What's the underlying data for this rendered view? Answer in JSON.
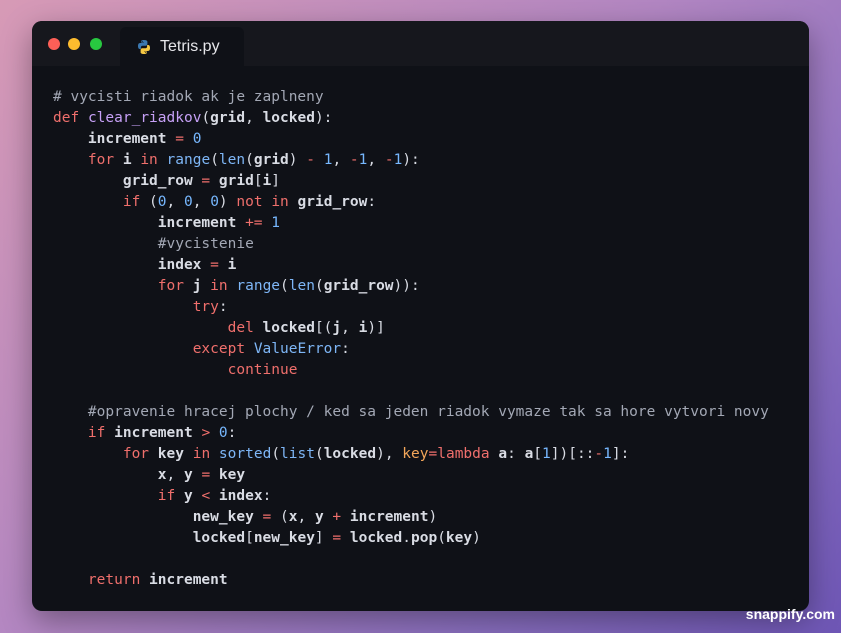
{
  "window": {
    "tab_title": "Tetris.py",
    "tab_icon": "python-icon"
  },
  "colors": {
    "close": "#fe5f57",
    "minimize": "#febc2e",
    "maximize": "#28c840",
    "editor_bg": "#0f1117",
    "keyword": "#ef6f6c",
    "function": "#c6a0f6",
    "builtin": "#7eb6f6",
    "number": "#77b8ff",
    "comment": "#a3a8b5",
    "param": "#f2a65a"
  },
  "code_lines": [
    [
      [
        "cm",
        "# vycisti riadok ak je zaplneny"
      ]
    ],
    [
      [
        "kw",
        "def"
      ],
      [
        "pn",
        " "
      ],
      [
        "fn",
        "clear_riadkov"
      ],
      [
        "pn",
        "("
      ],
      [
        "id",
        "grid"
      ],
      [
        "pn",
        ", "
      ],
      [
        "id",
        "locked"
      ],
      [
        "pn",
        "):"
      ]
    ],
    [
      [
        "pn",
        "    "
      ],
      [
        "id",
        "increment"
      ],
      [
        "pn",
        " "
      ],
      [
        "op",
        "="
      ],
      [
        "pn",
        " "
      ],
      [
        "num",
        "0"
      ]
    ],
    [
      [
        "pn",
        "    "
      ],
      [
        "kw",
        "for"
      ],
      [
        "pn",
        " "
      ],
      [
        "id",
        "i"
      ],
      [
        "pn",
        " "
      ],
      [
        "kw",
        "in"
      ],
      [
        "pn",
        " "
      ],
      [
        "bi",
        "range"
      ],
      [
        "pn",
        "("
      ],
      [
        "bi",
        "len"
      ],
      [
        "pn",
        "("
      ],
      [
        "id",
        "grid"
      ],
      [
        "pn",
        ") "
      ],
      [
        "op",
        "-"
      ],
      [
        "pn",
        " "
      ],
      [
        "num",
        "1"
      ],
      [
        "pn",
        ", "
      ],
      [
        "op",
        "-"
      ],
      [
        "num",
        "1"
      ],
      [
        "pn",
        ", "
      ],
      [
        "op",
        "-"
      ],
      [
        "num",
        "1"
      ],
      [
        "pn",
        "):"
      ]
    ],
    [
      [
        "pn",
        "        "
      ],
      [
        "id",
        "grid_row"
      ],
      [
        "pn",
        " "
      ],
      [
        "op",
        "="
      ],
      [
        "pn",
        " "
      ],
      [
        "id",
        "grid"
      ],
      [
        "pn",
        "["
      ],
      [
        "id",
        "i"
      ],
      [
        "pn",
        "]"
      ]
    ],
    [
      [
        "pn",
        "        "
      ],
      [
        "kw",
        "if"
      ],
      [
        "pn",
        " ("
      ],
      [
        "num",
        "0"
      ],
      [
        "pn",
        ", "
      ],
      [
        "num",
        "0"
      ],
      [
        "pn",
        ", "
      ],
      [
        "num",
        "0"
      ],
      [
        "pn",
        ") "
      ],
      [
        "kw",
        "not"
      ],
      [
        "pn",
        " "
      ],
      [
        "kw",
        "in"
      ],
      [
        "pn",
        " "
      ],
      [
        "id",
        "grid_row"
      ],
      [
        "pn",
        ":"
      ]
    ],
    [
      [
        "pn",
        "            "
      ],
      [
        "id",
        "increment"
      ],
      [
        "pn",
        " "
      ],
      [
        "op",
        "+="
      ],
      [
        "pn",
        " "
      ],
      [
        "num",
        "1"
      ]
    ],
    [
      [
        "pn",
        "            "
      ],
      [
        "cm",
        "#vycistenie"
      ]
    ],
    [
      [
        "pn",
        "            "
      ],
      [
        "id",
        "index"
      ],
      [
        "pn",
        " "
      ],
      [
        "op",
        "="
      ],
      [
        "pn",
        " "
      ],
      [
        "id",
        "i"
      ]
    ],
    [
      [
        "pn",
        "            "
      ],
      [
        "kw",
        "for"
      ],
      [
        "pn",
        " "
      ],
      [
        "id",
        "j"
      ],
      [
        "pn",
        " "
      ],
      [
        "kw",
        "in"
      ],
      [
        "pn",
        " "
      ],
      [
        "bi",
        "range"
      ],
      [
        "pn",
        "("
      ],
      [
        "bi",
        "len"
      ],
      [
        "pn",
        "("
      ],
      [
        "id",
        "grid_row"
      ],
      [
        "pn",
        ")):"
      ]
    ],
    [
      [
        "pn",
        "                "
      ],
      [
        "kw",
        "try"
      ],
      [
        "pn",
        ":"
      ]
    ],
    [
      [
        "pn",
        "                    "
      ],
      [
        "kw",
        "del"
      ],
      [
        "pn",
        " "
      ],
      [
        "id",
        "locked"
      ],
      [
        "pn",
        "[("
      ],
      [
        "id",
        "j"
      ],
      [
        "pn",
        ", "
      ],
      [
        "id",
        "i"
      ],
      [
        "pn",
        ")]"
      ]
    ],
    [
      [
        "pn",
        "                "
      ],
      [
        "kw",
        "except"
      ],
      [
        "pn",
        " "
      ],
      [
        "bi",
        "ValueError"
      ],
      [
        "pn",
        ":"
      ]
    ],
    [
      [
        "pn",
        "                    "
      ],
      [
        "kw",
        "continue"
      ]
    ],
    [
      [
        "pn",
        ""
      ]
    ],
    [
      [
        "pn",
        "    "
      ],
      [
        "cm",
        "#opravenie hracej plochy / ked sa jeden riadok vymaze tak sa hore vytvori novy"
      ]
    ],
    [
      [
        "pn",
        "    "
      ],
      [
        "kw",
        "if"
      ],
      [
        "pn",
        " "
      ],
      [
        "id",
        "increment"
      ],
      [
        "pn",
        " "
      ],
      [
        "op",
        ">"
      ],
      [
        "pn",
        " "
      ],
      [
        "num",
        "0"
      ],
      [
        "pn",
        ":"
      ]
    ],
    [
      [
        "pn",
        "        "
      ],
      [
        "kw",
        "for"
      ],
      [
        "pn",
        " "
      ],
      [
        "id",
        "key"
      ],
      [
        "pn",
        " "
      ],
      [
        "kw",
        "in"
      ],
      [
        "pn",
        " "
      ],
      [
        "bi",
        "sorted"
      ],
      [
        "pn",
        "("
      ],
      [
        "bi",
        "list"
      ],
      [
        "pn",
        "("
      ],
      [
        "id",
        "locked"
      ],
      [
        "pn",
        "), "
      ],
      [
        "pr",
        "key"
      ],
      [
        "op",
        "="
      ],
      [
        "kw",
        "lambda"
      ],
      [
        "pn",
        " "
      ],
      [
        "id",
        "a"
      ],
      [
        "pn",
        ": "
      ],
      [
        "id",
        "a"
      ],
      [
        "pn",
        "["
      ],
      [
        "num",
        "1"
      ],
      [
        "pn",
        "])[::"
      ],
      [
        "op",
        "-"
      ],
      [
        "num",
        "1"
      ],
      [
        "pn",
        "]:"
      ]
    ],
    [
      [
        "pn",
        "            "
      ],
      [
        "id",
        "x"
      ],
      [
        "pn",
        ", "
      ],
      [
        "id",
        "y"
      ],
      [
        "pn",
        " "
      ],
      [
        "op",
        "="
      ],
      [
        "pn",
        " "
      ],
      [
        "id",
        "key"
      ]
    ],
    [
      [
        "pn",
        "            "
      ],
      [
        "kw",
        "if"
      ],
      [
        "pn",
        " "
      ],
      [
        "id",
        "y"
      ],
      [
        "pn",
        " "
      ],
      [
        "op",
        "<"
      ],
      [
        "pn",
        " "
      ],
      [
        "id",
        "index"
      ],
      [
        "pn",
        ":"
      ]
    ],
    [
      [
        "pn",
        "                "
      ],
      [
        "id",
        "new_key"
      ],
      [
        "pn",
        " "
      ],
      [
        "op",
        "="
      ],
      [
        "pn",
        " ("
      ],
      [
        "id",
        "x"
      ],
      [
        "pn",
        ", "
      ],
      [
        "id",
        "y"
      ],
      [
        "pn",
        " "
      ],
      [
        "op",
        "+"
      ],
      [
        "pn",
        " "
      ],
      [
        "id",
        "increment"
      ],
      [
        "pn",
        ")"
      ]
    ],
    [
      [
        "pn",
        "                "
      ],
      [
        "id",
        "locked"
      ],
      [
        "pn",
        "["
      ],
      [
        "id",
        "new_key"
      ],
      [
        "pn",
        "] "
      ],
      [
        "op",
        "="
      ],
      [
        "pn",
        " "
      ],
      [
        "id",
        "locked"
      ],
      [
        "pn",
        "."
      ],
      [
        "id",
        "pop"
      ],
      [
        "pn",
        "("
      ],
      [
        "id",
        "key"
      ],
      [
        "pn",
        ")"
      ]
    ],
    [
      [
        "pn",
        ""
      ]
    ],
    [
      [
        "pn",
        "    "
      ],
      [
        "kw",
        "return"
      ],
      [
        "pn",
        " "
      ],
      [
        "id",
        "increment"
      ]
    ]
  ],
  "watermark": "snappify.com"
}
